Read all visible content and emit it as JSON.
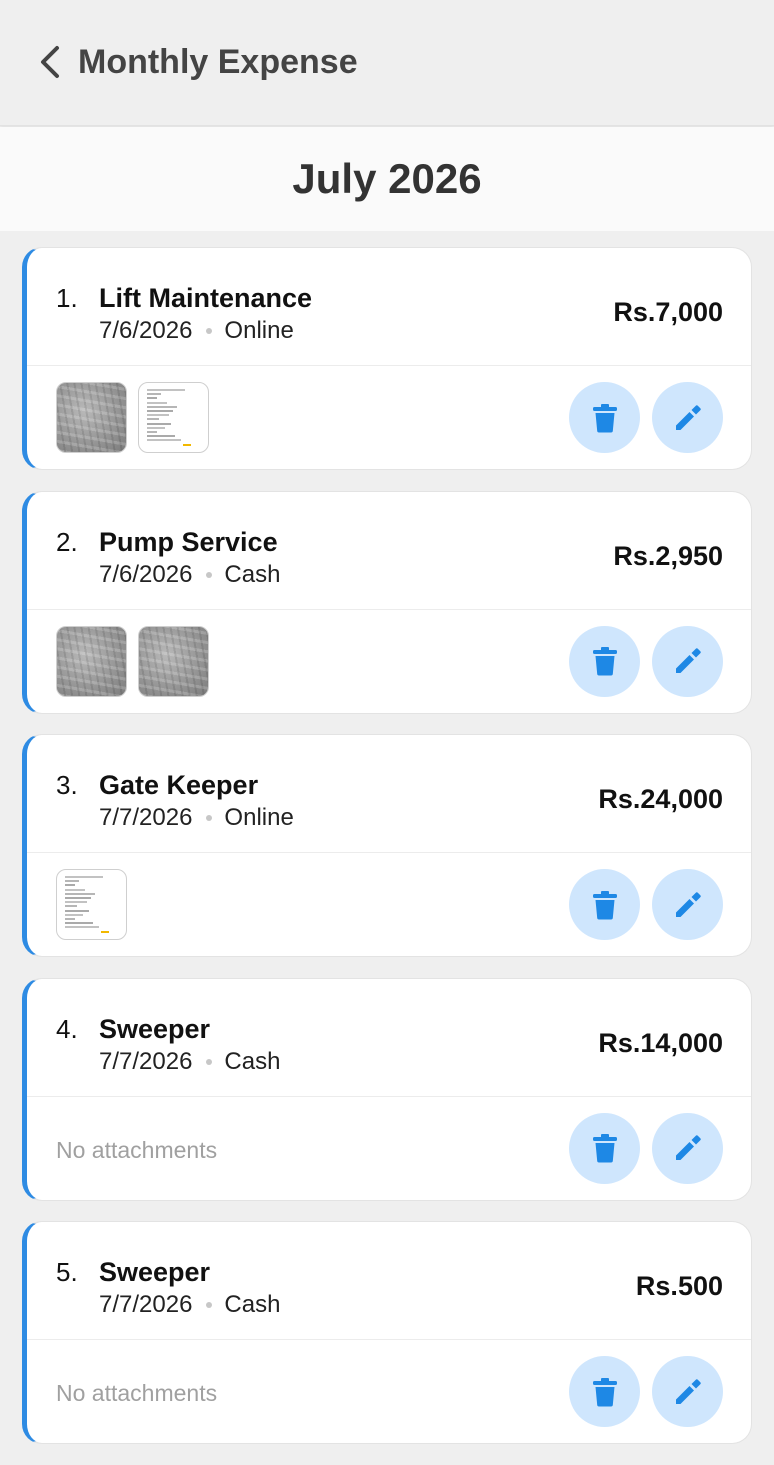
{
  "header": {
    "title": "Monthly Expense",
    "back_icon": "chevron-left-icon"
  },
  "month": {
    "label": "July 2026"
  },
  "colors": {
    "accent": "#2e8be3",
    "action_bg": "#cfe6fd",
    "action_icon": "#1e88e5"
  },
  "expenses": [
    {
      "index": "1.",
      "name": "Lift Maintenance",
      "date": "7/6/2026",
      "method": "Online",
      "amount": "Rs.7,000",
      "attachments": [
        "scan",
        "doc"
      ]
    },
    {
      "index": "2.",
      "name": "Pump Service",
      "date": "7/6/2026",
      "method": "Cash",
      "amount": "Rs.2,950",
      "attachments": [
        "scan",
        "scan"
      ]
    },
    {
      "index": "3.",
      "name": "Gate Keeper",
      "date": "7/7/2026",
      "method": "Online",
      "amount": "Rs.24,000",
      "attachments": [
        "doc"
      ]
    },
    {
      "index": "4.",
      "name": "Sweeper",
      "date": "7/7/2026",
      "method": "Cash",
      "amount": "Rs.14,000",
      "attachments": [],
      "empty_label": "No attachments"
    },
    {
      "index": "5.",
      "name": "Sweeper",
      "date": "7/7/2026",
      "method": "Cash",
      "amount": "Rs.500",
      "attachments": [],
      "empty_label": "No attachments"
    }
  ]
}
